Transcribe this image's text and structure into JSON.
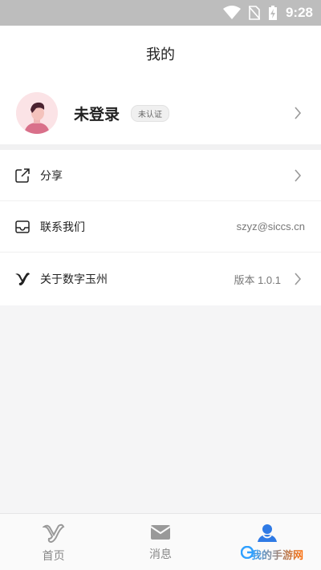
{
  "status_bar": {
    "time": "9:28"
  },
  "header": {
    "title": "我的"
  },
  "profile": {
    "name": "未登录",
    "badge": "未认证"
  },
  "menu": {
    "items": [
      {
        "label": "分享",
        "value": ""
      },
      {
        "label": "联系我们",
        "value": "szyz@siccs.cn"
      },
      {
        "label": "关于数字玉州",
        "value": "版本 1.0.1"
      }
    ]
  },
  "tabbar": {
    "tabs": [
      {
        "label": "首页"
      },
      {
        "label": "消息"
      },
      {
        "label": "我的"
      }
    ]
  },
  "watermark": "我的手游网",
  "colors": {
    "accent": "#2f7ae5",
    "avatar_bg": "#fbe3e6"
  }
}
